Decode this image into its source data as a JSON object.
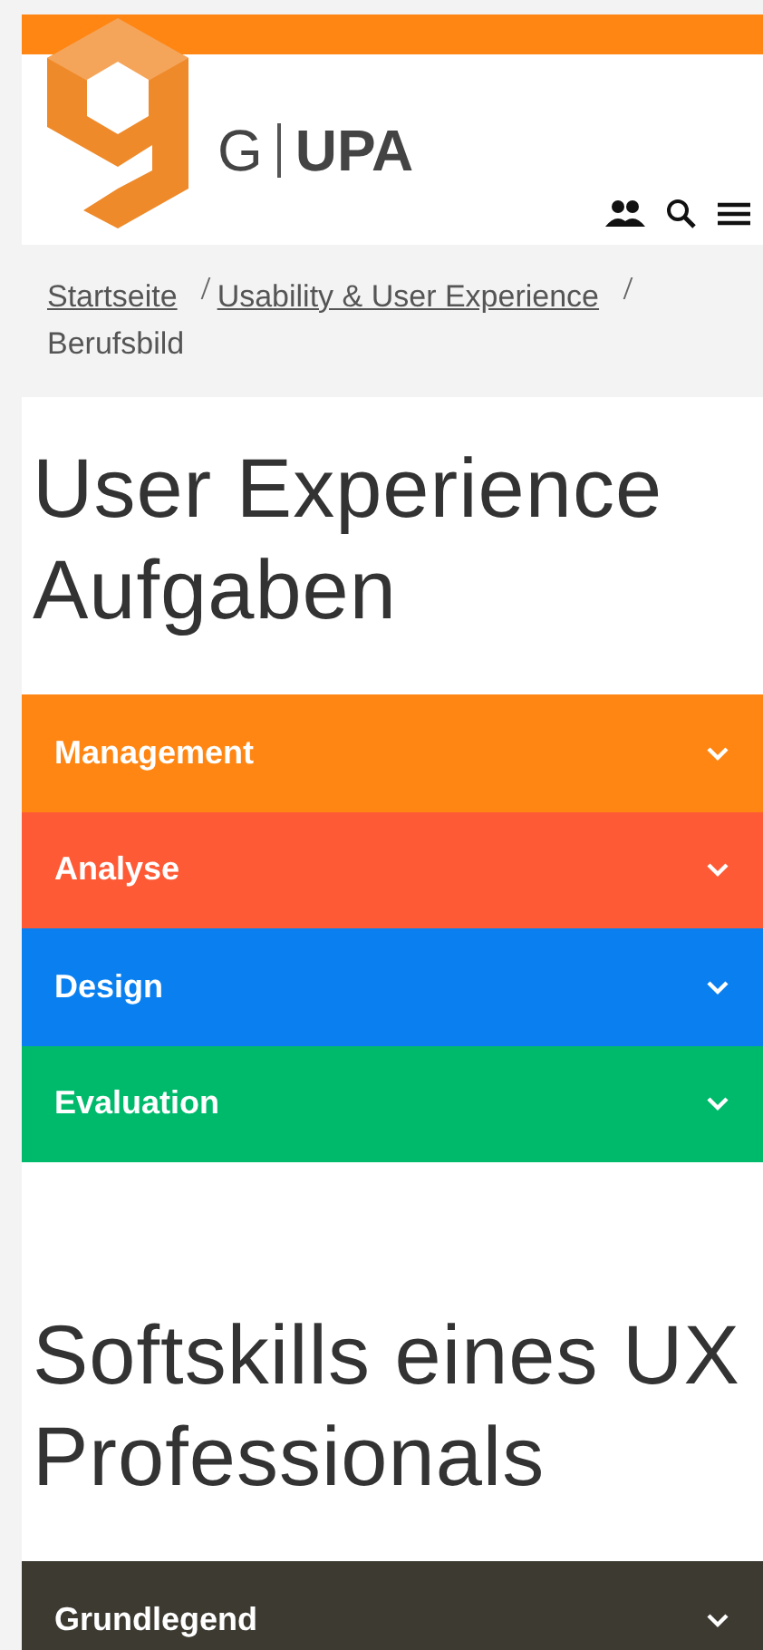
{
  "logo": {
    "text_left": "G",
    "text_right": "UPA"
  },
  "breadcrumb": [
    {
      "label": "Startseite",
      "kind": "link"
    },
    {
      "label": "Usability & User Experience",
      "kind": "link"
    },
    {
      "label": "Berufsbild",
      "kind": "current"
    }
  ],
  "sections": [
    {
      "title": "User Experience Aufgaben",
      "items": [
        {
          "label": "Management",
          "color": "#ff8613",
          "expanded": false
        },
        {
          "label": "Analyse",
          "color": "#ff5a36",
          "expanded": false
        },
        {
          "label": "Design",
          "color": "#0a80f0",
          "expanded": false
        },
        {
          "label": "Evaluation",
          "color": "#00ba6c",
          "expanded": false
        }
      ]
    },
    {
      "title": "Softskills eines UX Professionals",
      "items": [
        {
          "label": "Grundlegend",
          "color": "#3d3a32",
          "expanded": false
        }
      ]
    }
  ]
}
